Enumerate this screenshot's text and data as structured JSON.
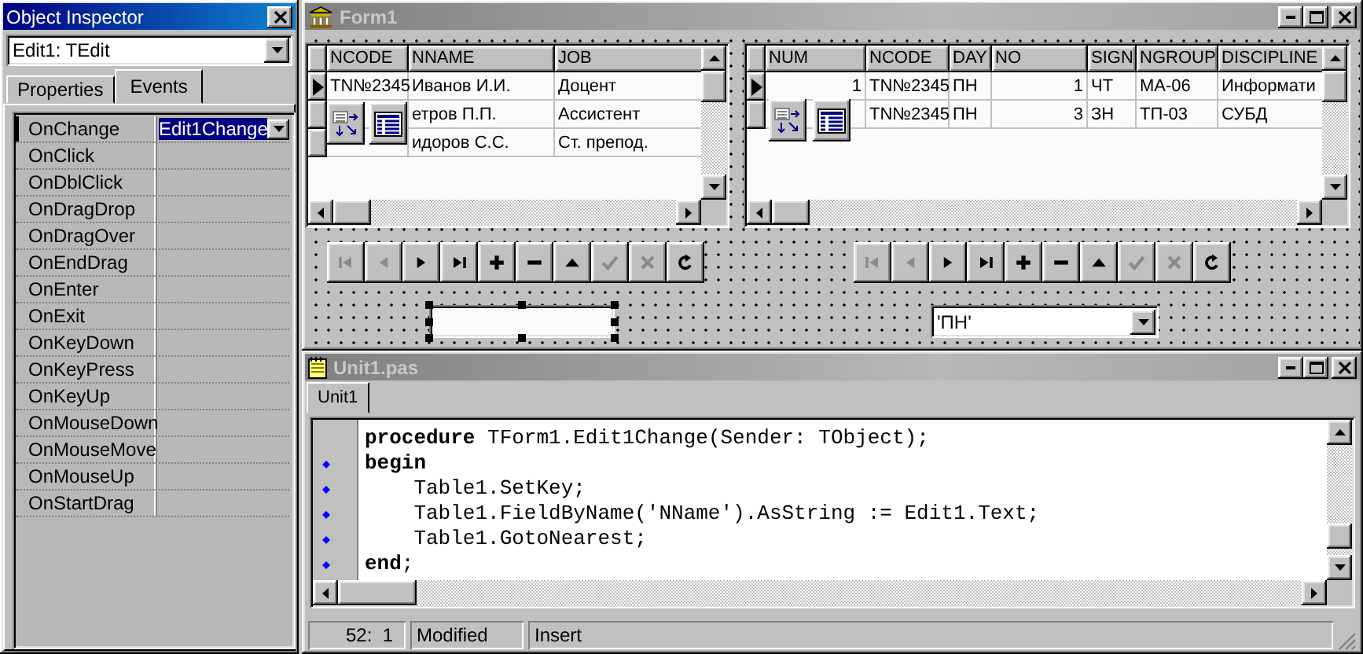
{
  "object_inspector": {
    "title": "Object Inspector",
    "component": "Edit1: TEdit",
    "tabs": [
      {
        "label": "Properties",
        "selected": false
      },
      {
        "label": "Events",
        "selected": true
      }
    ],
    "events": [
      {
        "name": "OnChange",
        "value": "Edit1Change",
        "selected": true
      },
      {
        "name": "OnClick",
        "selected": false
      },
      {
        "name": "OnDblClick",
        "selected": false
      },
      {
        "name": "OnDragDrop",
        "selected": false
      },
      {
        "name": "OnDragOver",
        "selected": false
      },
      {
        "name": "OnEndDrag",
        "selected": false
      },
      {
        "name": "OnEnter",
        "selected": false
      },
      {
        "name": "OnExit",
        "selected": false
      },
      {
        "name": "OnKeyDown",
        "selected": false
      },
      {
        "name": "OnKeyPress",
        "selected": false
      },
      {
        "name": "OnKeyUp",
        "selected": false
      },
      {
        "name": "OnMouseDown",
        "selected": false
      },
      {
        "name": "OnMouseMove",
        "selected": false
      },
      {
        "name": "OnMouseUp",
        "selected": false
      },
      {
        "name": "OnStartDrag",
        "selected": false
      }
    ]
  },
  "form": {
    "title": "Form1",
    "grids": [
      {
        "columns": [
          "NCODE",
          "NNAME",
          "JOB"
        ],
        "rows": [
          {
            "current": true,
            "cells": [
              "TN№2345",
              "Иванов И.И.",
              "Доцент"
            ]
          },
          {
            "current": false,
            "cells": [
              "",
              "етров П.П.",
              "Ассистент"
            ]
          },
          {
            "current": false,
            "cells": [
              "",
              "идоров С.С.",
              "Ст. препод."
            ]
          }
        ]
      },
      {
        "columns": [
          "NUM",
          "NCODE",
          "DAY",
          "NO",
          "SIGN",
          "NGROUP",
          "DISCIPLINE"
        ],
        "rows": [
          {
            "current": true,
            "cells": [
              "1",
              "TN№2345",
              "ПН",
              "1",
              "ЧТ",
              "МА-06",
              "Информати"
            ]
          },
          {
            "current": false,
            "cells": [
              "",
              "TN№2345",
              "ПН",
              "3",
              "ЗН",
              "ТП-03",
              "СУБД"
            ]
          }
        ]
      }
    ],
    "navigators": [
      {
        "buttons": [
          {
            "kind": "first",
            "enabled": false
          },
          {
            "kind": "prior",
            "enabled": false
          },
          {
            "kind": "next",
            "enabled": true
          },
          {
            "kind": "last",
            "enabled": true
          },
          {
            "kind": "insert",
            "enabled": true
          },
          {
            "kind": "delete",
            "enabled": true
          },
          {
            "kind": "edit",
            "enabled": true
          },
          {
            "kind": "post",
            "enabled": false
          },
          {
            "kind": "cancel",
            "enabled": false
          },
          {
            "kind": "refresh",
            "enabled": true
          }
        ]
      },
      {
        "buttons": [
          {
            "kind": "first",
            "enabled": false
          },
          {
            "kind": "prior",
            "enabled": false
          },
          {
            "kind": "next",
            "enabled": true
          },
          {
            "kind": "last",
            "enabled": true
          },
          {
            "kind": "insert",
            "enabled": true
          },
          {
            "kind": "delete",
            "enabled": true
          },
          {
            "kind": "edit",
            "enabled": true
          },
          {
            "kind": "post",
            "enabled": false
          },
          {
            "kind": "cancel",
            "enabled": false
          },
          {
            "kind": "refresh",
            "enabled": true
          }
        ]
      }
    ],
    "edit_field": {
      "selected": true
    },
    "combo": {
      "value": "'ПН'"
    }
  },
  "editor": {
    "title": "Unit1.pas",
    "tabs": [
      {
        "label": "Unit1",
        "selected": true
      }
    ],
    "lines": [
      {
        "text": "**procedure** TForm1.Edit1Change(Sender: TObject);",
        "marker": false
      },
      {
        "text": "**begin**",
        "marker": true
      },
      {
        "text": "    Table1.SetKey;",
        "marker": true
      },
      {
        "text": "    Table1.FieldByName('NName').AsString := Edit1.Text;",
        "marker": true
      },
      {
        "text": "    Table1.GotoNearest;",
        "marker": true
      },
      {
        "text": "**end**;",
        "marker": true
      }
    ],
    "status_bar": [
      "52:  1",
      "Modified",
      "Insert"
    ]
  }
}
